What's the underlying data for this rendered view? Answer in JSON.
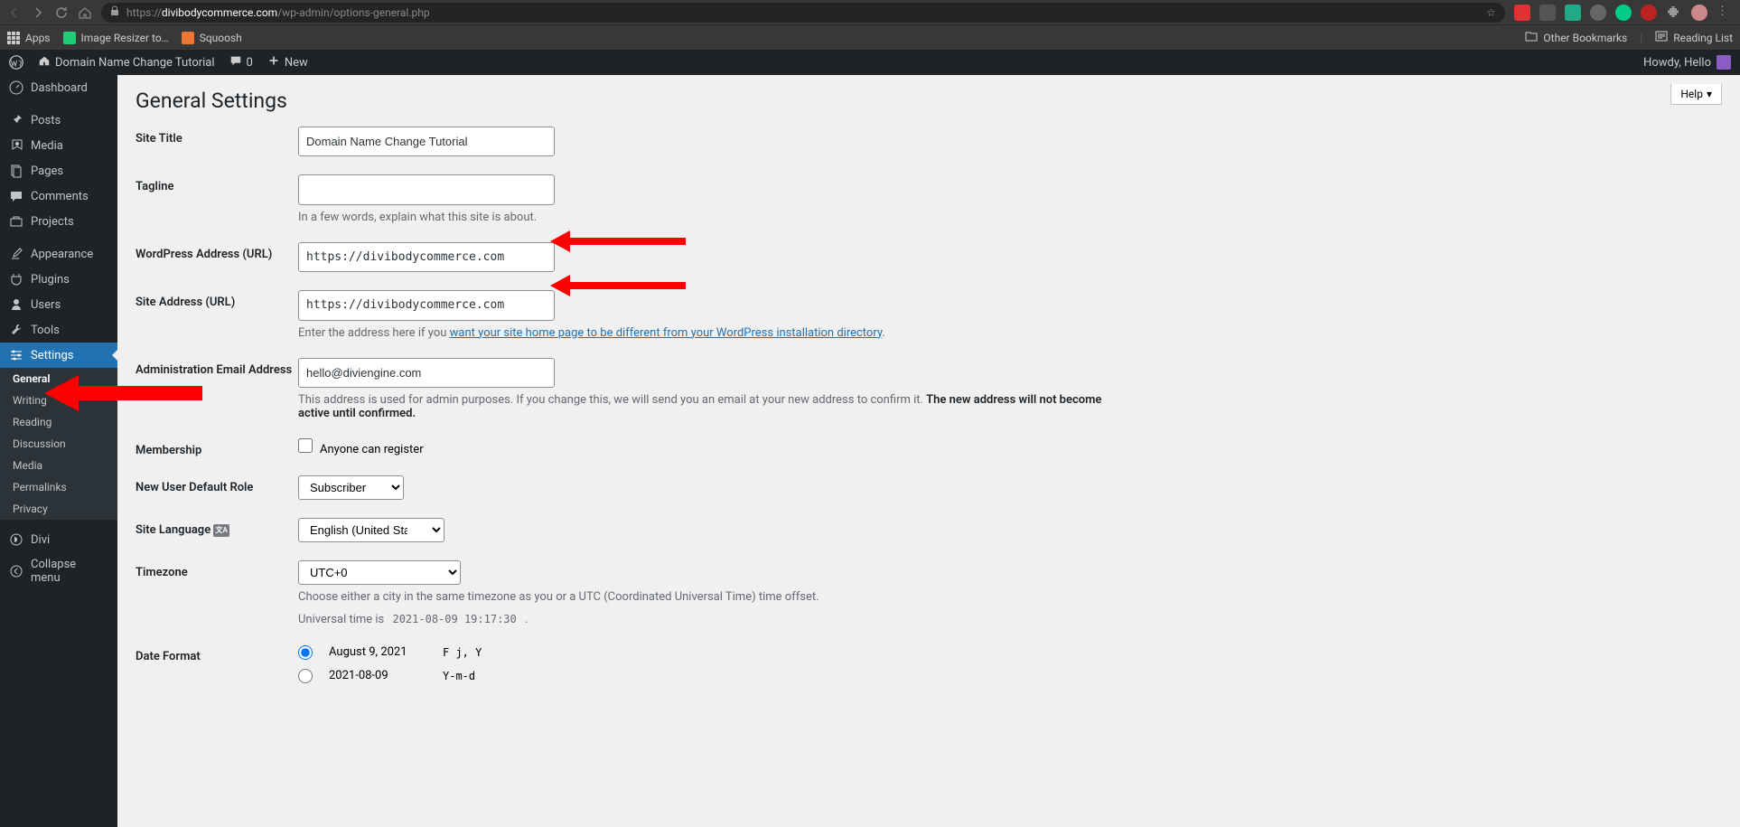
{
  "browser": {
    "url_prefix": "https://",
    "url_domain": "divibodycommerce.com",
    "url_path": "/wp-admin/options-general.php",
    "bookmarks": {
      "apps": "Apps",
      "image_resizer": "Image Resizer to…",
      "squoosh": "Squoosh",
      "other_bookmarks": "Other Bookmarks",
      "reading_list": "Reading List"
    }
  },
  "wp_bar": {
    "site_name": "Domain Name Change Tutorial",
    "comment_count": "0",
    "new_label": "New",
    "howdy": "Howdy, Hello"
  },
  "sidebar": {
    "dashboard": "Dashboard",
    "posts": "Posts",
    "media": "Media",
    "pages": "Pages",
    "comments": "Comments",
    "projects": "Projects",
    "appearance": "Appearance",
    "plugins": "Plugins",
    "users": "Users",
    "tools": "Tools",
    "settings": "Settings",
    "divi": "Divi",
    "collapse": "Collapse menu",
    "submenu": {
      "general": "General",
      "writing": "Writing",
      "reading": "Reading",
      "discussion": "Discussion",
      "media": "Media",
      "permalinks": "Permalinks",
      "privacy": "Privacy"
    }
  },
  "page": {
    "title": "General Settings",
    "help": "Help"
  },
  "form": {
    "site_title": {
      "label": "Site Title",
      "value": "Domain Name Change Tutorial"
    },
    "tagline": {
      "label": "Tagline",
      "value": "",
      "desc": "In a few words, explain what this site is about."
    },
    "wp_url": {
      "label": "WordPress Address (URL)",
      "value": "https://divibodycommerce.com"
    },
    "site_url": {
      "label": "Site Address (URL)",
      "value": "https://divibodycommerce.com",
      "desc_pre": "Enter the address here if you ",
      "desc_link": "want your site home page to be different from your WordPress installation directory",
      "desc_post": "."
    },
    "admin_email": {
      "label": "Administration Email Address",
      "value": "hello@diviengine.com",
      "desc_pre": "This address is used for admin purposes. If you change this, we will send you an email at your new address to confirm it. ",
      "desc_strong": "The new address will not become active until confirmed."
    },
    "membership": {
      "label": "Membership",
      "checkbox_label": "Anyone can register"
    },
    "default_role": {
      "label": "New User Default Role",
      "value": "Subscriber"
    },
    "language": {
      "label": "Site Language",
      "value": "English (United States)"
    },
    "timezone": {
      "label": "Timezone",
      "value": "UTC+0",
      "desc": "Choose either a city in the same timezone as you or a UTC (Coordinated Universal Time) time offset.",
      "utime_pre": "Universal time is ",
      "utime_val": "2021-08-09 19:17:30",
      "utime_post": " ."
    },
    "date_format": {
      "label": "Date Format",
      "opt1_label": "August 9, 2021",
      "opt1_code": "F j, Y",
      "opt2_label": "2021-08-09",
      "opt2_code": "Y-m-d"
    }
  }
}
